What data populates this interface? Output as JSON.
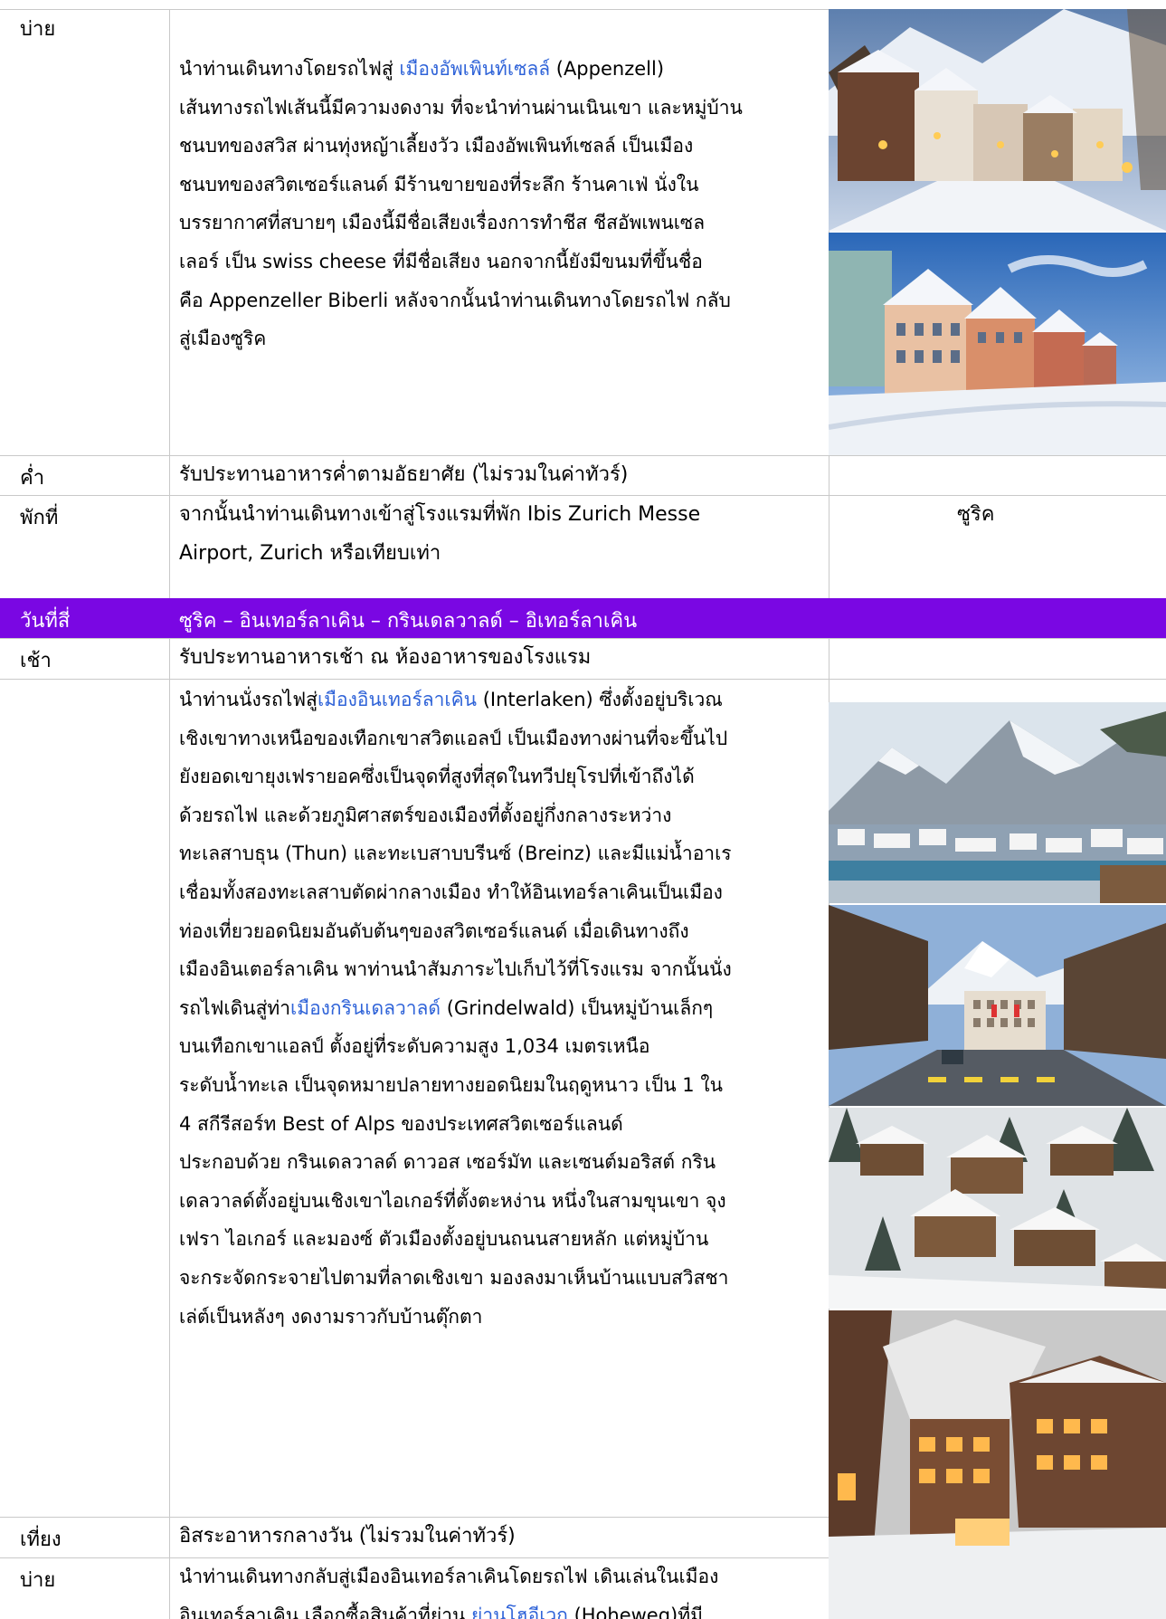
{
  "rows": {
    "afternoon1": {
      "label": "บ่าย",
      "paragraph": [
        [
          {
            "t": "นำท่านเดินทางโดยรถไฟสู่ "
          },
          {
            "t": "เมืองอัพเพินท์เซลล์",
            "link": true
          },
          {
            "t": " (Appenzell)"
          }
        ],
        [
          {
            "t": "เส้นทางรถไฟเส้นนี้มีความงดงาม ที่จะนำท่านผ่านเนินเขา และหมู่บ้าน"
          }
        ],
        [
          {
            "t": "ชนบทของสวิส ผ่านทุ่งหญ้าเลี้ยงวัว เมืองอัพเพินท์เซลล์ เป็นเมือง"
          }
        ],
        [
          {
            "t": "ชนบทของสวิตเซอร์แลนด์ มีร้านขายของที่ระลึก ร้านคาเฟ่ นั่งใน"
          }
        ],
        [
          {
            "t": "บรรยากาศที่สบายๆ เมืองนี้มีชื่อเสียงเรื่องการทำชีส ชีสอัพเพนเซล"
          }
        ],
        [
          {
            "t": "เลอร์  เป็น swiss cheese ที่มีชื่อเสียง นอกจากนี้ยังมีขนมที่ขึ้นชื่อ"
          }
        ],
        [
          {
            "t": "คือ Appenzeller Biberli หลังจากนั้นนำท่านเดินทางโดยรถไฟ กลับ"
          }
        ],
        [
          {
            "t": "สู่เมืองซูริค"
          }
        ]
      ]
    },
    "dinner": {
      "label": "ค่ำ",
      "text": "รับประทานอาหารค่ำตามอัธยาศัย (ไม่รวมในค่าทัวร์)"
    },
    "hotel": {
      "label": "พักที่",
      "lines": [
        "จากนั้นนำท่านเดินทางเข้าสู่โรงแรมที่พัก Ibis Zurich Messe",
        "Airport, Zurich หรือเทียบเท่า"
      ],
      "city": "ซูริค"
    },
    "day4": {
      "label": "วันที่สี่",
      "title": "ซูริค – อินเทอร์ลาเคิน – กรินเดลวาลด์ – อิเทอร์ลาเคิน"
    },
    "breakfast": {
      "label": "เช้า",
      "text": "รับประทานอาหารเช้า ณ ห้องอาหารของโรงแรม"
    },
    "interlaken": {
      "paragraph": [
        [
          {
            "t": "นำท่านนั่งรถไฟสู่"
          },
          {
            "t": "เมืองอินเทอร์ลาเคิน",
            "link": true
          },
          {
            "t": " (Interlaken) ซึ่งตั้งอยู่บริเวณ"
          }
        ],
        [
          {
            "t": "เชิงเขาทางเหนือของเทือกเขาสวิตแอลป์ เป็นเมืองทางผ่านที่จะขึ้นไป"
          }
        ],
        [
          {
            "t": "ยังยอดเขายุงเฟรายอคซึ่งเป็นจุดที่สูงที่สุดในทวีปยุโรปที่เข้าถึงได้"
          }
        ],
        [
          {
            "t": "ด้วยรถไฟ และด้วยภูมิศาสตร์ของเมืองที่ตั้งอยู่กึ่งกลางระหว่าง"
          }
        ],
        [
          {
            "t": "ทะเลสาบธุน (Thun) และทะเบสาบบรีนซ์ (Breinz) และมีแม่น้ำอาเร"
          }
        ],
        [
          {
            "t": "เชื่อมทั้งสองทะเลสาบตัดผ่ากลางเมือง ทำให้อินเทอร์ลาเคินเป็นเมือง"
          }
        ],
        [
          {
            "t": "ท่องเที่ยวยอดนิยมอันดับต้นๆของสวิตเซอร์แลนด์ เมื่อเดินทางถึง"
          }
        ],
        [
          {
            "t": "เมืองอินเตอร์ลาเคิน พาท่านนำสัมภาระไปเก็บไว้ที่โรงแรม จากนั้นนั่ง"
          }
        ],
        [
          {
            "t": "รถไฟเดินสู่ท่า"
          },
          {
            "t": "เมืองกรินเดลวาลด์",
            "link": true
          },
          {
            "t": " (Grindelwald) เป็นหมู่บ้านเล็กๆ"
          }
        ],
        [
          {
            "t": "บนเทือกเขาแอลป์ ตั้งอยู่ที่ระดับความสูง 1,034 เมตรเหนือ"
          }
        ],
        [
          {
            "t": "ระดับน้ำทะเล เป็นจุดหมายปลายทางยอดนิยมในฤดูหนาว เป็น 1 ใน"
          }
        ],
        [
          {
            "t": "4 สกีรีสอร์ท Best of Alps ของประเทศสวิตเซอร์แลนด์"
          }
        ],
        [
          {
            "t": "ประกอบด้วย กรินเดลวาลด์ ดาวอส เซอร์มัท และเซนต์มอริสต์ กริน"
          }
        ],
        [
          {
            "t": "เดลวาลด์ตั้งอยู่บนเชิงเขาไอเกอร์ที่ตั้งตะหง่าน หนึ่งในสามขุนเขา จุง"
          }
        ],
        [
          {
            "t": "เฟรา ไอเกอร์ และมองซ์ ตัวเมืองตั้งอยู่บนถนนสายหลัก แต่หมู่บ้าน"
          }
        ],
        [
          {
            "t": "จะกระจัดกระจายไปตามที่ลาดเชิงเขา มองลงมาเห็นบ้านแบบสวิสชา"
          }
        ],
        [
          {
            "t": "เล่ต์เป็นหลังๆ งดงามราวกับบ้านตุ๊กตา"
          }
        ]
      ]
    },
    "lunch": {
      "label": "เที่ยง",
      "text": "อิสระอาหารกลางวัน (ไม่รวมในค่าทัวร์)"
    },
    "afternoon2": {
      "label": "บ่าย",
      "paragraph": [
        [
          {
            "t": "นำท่านเดินทางกลับสู่เมืองอินเทอร์ลาเคินโดยรถไฟ เดินเล่นในเมือง"
          }
        ],
        [
          {
            "t": "อินเทอร์ลาเคิน เลือกซื้อสินค้าที่ย่าน "
          },
          {
            "t": "ย่านโฮอีเวก",
            "link": true
          },
          {
            "t": " (Hoheweg)ที่มี"
          }
        ]
      ]
    }
  },
  "colors": {
    "link": "#2f63d8",
    "day_bar": "#7a07e3",
    "grid": "#c9c9c9"
  }
}
